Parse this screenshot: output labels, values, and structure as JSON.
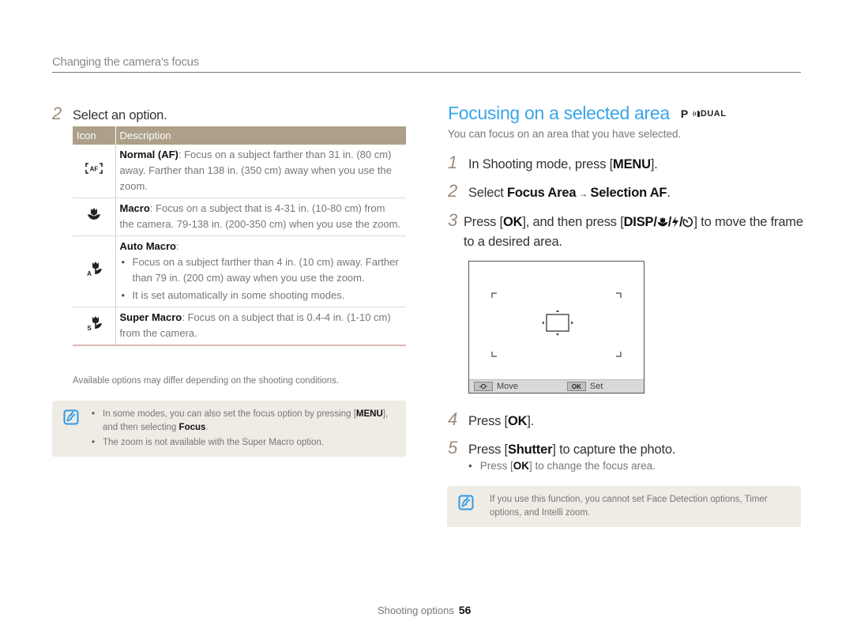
{
  "header": {
    "section_title": "Changing the camera’s focus"
  },
  "left": {
    "step": {
      "number": "2",
      "text": "Select an option."
    },
    "table": {
      "columns": [
        "Icon",
        "Description"
      ],
      "rows": [
        {
          "icon": "af-normal-icon",
          "title": "Normal (AF)",
          "text": ": Focus on a subject farther than 31 in. (80 cm) away. Farther than 138 in. (350 cm) away when you use the zoom."
        },
        {
          "icon": "macro-icon",
          "title": "Macro",
          "text": ": Focus on a subject that is 4-31 in. (10-80 cm) from the camera. 79-138 in. (200-350 cm) when you use the zoom."
        },
        {
          "icon": "auto-macro-icon",
          "title": "Auto Macro",
          "text": ":",
          "bullets": [
            "Focus on a subject farther than 4 in. (10 cm) away. Farther than 79 in. (200 cm) away when you use the zoom.",
            "It is set automatically in some shooting modes."
          ]
        },
        {
          "icon": "super-macro-icon",
          "title": "Super Macro",
          "text": ": Focus on a subject that is 0.4-4 in. (1-10 cm) from the camera."
        }
      ]
    },
    "availability_note": "Available options may differ depending on the shooting conditions.",
    "note": {
      "icon": "note-icon",
      "items": [
        {
          "pre": "In some modes, you can also set the focus option by pressing [",
          "key": "MENU",
          "mid": "], and then selecting ",
          "bold": "Focus",
          "post": "."
        },
        {
          "text": "The zoom is not available with the Super Macro option."
        }
      ]
    }
  },
  "right": {
    "heading": "Focusing on a selected area",
    "mode_icons": {
      "p": "P",
      "dual": "DUAL"
    },
    "intro": "You can focus on an area that you have selected.",
    "steps": [
      {
        "number": "1",
        "pre": "In Shooting mode, press [",
        "key": "MENU",
        "post": "]."
      },
      {
        "number": "2",
        "pre": "Select ",
        "bold1": "Focus Area",
        "arrow": " → ",
        "bold2": "Selection AF",
        "post": "."
      },
      {
        "number": "3",
        "pre": "Press [",
        "key": "OK",
        "mid": "], and then press [",
        "key2": "DISP",
        "post": "] to move the frame to a desired area."
      },
      {
        "number": "4",
        "pre": "Press [",
        "key": "OK",
        "post": "]."
      },
      {
        "number": "5",
        "pre": "Press [",
        "key": "Shutter",
        "post": "] to capture the photo."
      }
    ],
    "sub_bullet": {
      "pre": "Press [",
      "key": "OK",
      "post": "] to change the focus area."
    },
    "camera_screen": {
      "move_label": "Move",
      "ok_button": "OK",
      "set_label": "Set"
    },
    "note": {
      "icon": "note-icon",
      "text": "If you use this function, you cannot set Face Detection options, Timer options, and Intelli zoom."
    }
  },
  "footer": {
    "section": "Shooting options",
    "page": "56"
  }
}
